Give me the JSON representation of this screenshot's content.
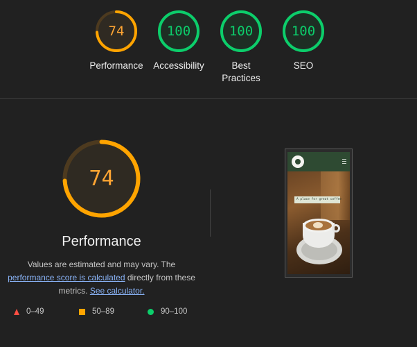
{
  "summary_gauges": [
    {
      "score": "74",
      "label": "Performance",
      "value": 0.74,
      "color": "#ffa400",
      "text_color": "#ffa533",
      "ring_bg": "#4d3a1f"
    },
    {
      "score": "100",
      "label": "Accessibility",
      "value": 1.0,
      "color": "#0cce6b",
      "text_color": "#0cce6b",
      "ring_bg": "#1f4a2e"
    },
    {
      "score": "100",
      "label": "Best Practices",
      "value": 1.0,
      "color": "#0cce6b",
      "text_color": "#0cce6b",
      "ring_bg": "#1f4a2e"
    },
    {
      "score": "100",
      "label": "SEO",
      "value": 1.0,
      "color": "#0cce6b",
      "text_color": "#0cce6b",
      "ring_bg": "#1f4a2e"
    }
  ],
  "performance": {
    "score": "74",
    "value": 0.74,
    "title": "Performance",
    "desc_prefix": "Values are estimated and may vary. The ",
    "desc_link1": "performance score is calculated",
    "desc_middle": " directly from these metrics. ",
    "desc_link2": "See calculator."
  },
  "legend": [
    {
      "icon": "triangle-icon",
      "range": "0–49",
      "color": "#ff4e42"
    },
    {
      "icon": "square-icon",
      "range": "50–89",
      "color": "#ffa400"
    },
    {
      "icon": "circle-icon",
      "range": "90–100",
      "color": "#0cce6b"
    }
  ],
  "screenshot": {
    "tagline": "A place for great coffee"
  }
}
